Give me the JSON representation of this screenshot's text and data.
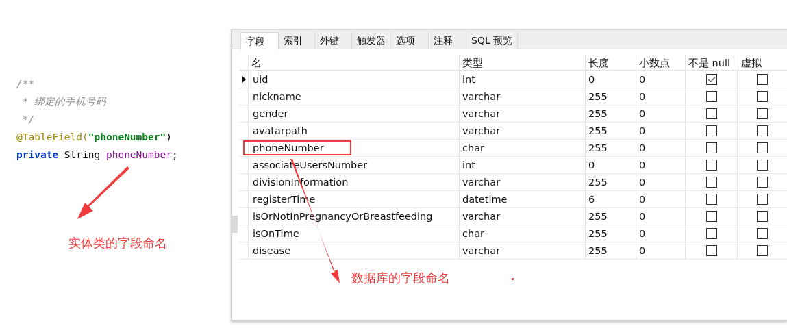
{
  "code": {
    "lines": [
      [
        {
          "kind": "comment",
          "text": "/**"
        }
      ],
      [
        {
          "kind": "comment",
          "text": " * 绑定的手机号码"
        }
      ],
      [
        {
          "kind": "comment",
          "text": " */"
        }
      ],
      [
        {
          "kind": "annotation",
          "text": "@TableField("
        },
        {
          "kind": "string",
          "text": "\"phoneNumber\""
        },
        {
          "kind": "plain",
          "text": ")"
        }
      ],
      [
        {
          "kind": "keyword",
          "text": "private "
        },
        {
          "kind": "plain",
          "text": "String "
        },
        {
          "kind": "field",
          "text": "phoneNumber"
        },
        {
          "kind": "plain",
          "text": ";"
        }
      ]
    ]
  },
  "code_note": "实体类的字段命名",
  "tabs": [
    {
      "label": "字段",
      "selected": true
    },
    {
      "label": "索引",
      "selected": false
    },
    {
      "label": "外键",
      "selected": false
    },
    {
      "label": "触发器",
      "selected": false
    },
    {
      "label": "选项",
      "selected": false
    },
    {
      "label": "注释",
      "selected": false
    },
    {
      "label": "SQL 预览",
      "selected": false
    }
  ],
  "table": {
    "columns": [
      "名",
      "类型",
      "长度",
      "小数点",
      "不是 null",
      "虚拟"
    ],
    "rows": [
      {
        "name": "uid",
        "type": "int",
        "length": "0",
        "decimals": "0",
        "not_null": true,
        "virtual": false,
        "selected": true,
        "highlighted": false
      },
      {
        "name": "nickname",
        "type": "varchar",
        "length": "255",
        "decimals": "0",
        "not_null": false,
        "virtual": false,
        "selected": false,
        "highlighted": false
      },
      {
        "name": "gender",
        "type": "varchar",
        "length": "255",
        "decimals": "0",
        "not_null": false,
        "virtual": false,
        "selected": false,
        "highlighted": false
      },
      {
        "name": "avatarpath",
        "type": "varchar",
        "length": "255",
        "decimals": "0",
        "not_null": false,
        "virtual": false,
        "selected": false,
        "highlighted": false
      },
      {
        "name": "phoneNumber",
        "type": "char",
        "length": "255",
        "decimals": "0",
        "not_null": false,
        "virtual": false,
        "selected": false,
        "highlighted": true
      },
      {
        "name": "associateUsersNumber",
        "type": "int",
        "length": "0",
        "decimals": "0",
        "not_null": false,
        "virtual": false,
        "selected": false,
        "highlighted": false
      },
      {
        "name": "divisionInformation",
        "type": "varchar",
        "length": "255",
        "decimals": "0",
        "not_null": false,
        "virtual": false,
        "selected": false,
        "highlighted": false
      },
      {
        "name": "registerTime",
        "type": "datetime",
        "length": "6",
        "decimals": "0",
        "not_null": false,
        "virtual": false,
        "selected": false,
        "highlighted": false
      },
      {
        "name": "isOrNotInPregnancyOrBreastfeeding",
        "type": "varchar",
        "length": "255",
        "decimals": "0",
        "not_null": false,
        "virtual": false,
        "selected": false,
        "highlighted": false
      },
      {
        "name": "isOnTime",
        "type": "char",
        "length": "255",
        "decimals": "0",
        "not_null": false,
        "virtual": false,
        "selected": false,
        "highlighted": false
      },
      {
        "name": "disease",
        "type": "varchar",
        "length": "255",
        "decimals": "0",
        "not_null": false,
        "virtual": false,
        "selected": false,
        "highlighted": false
      }
    ]
  },
  "table_note": "数据库的字段命名"
}
